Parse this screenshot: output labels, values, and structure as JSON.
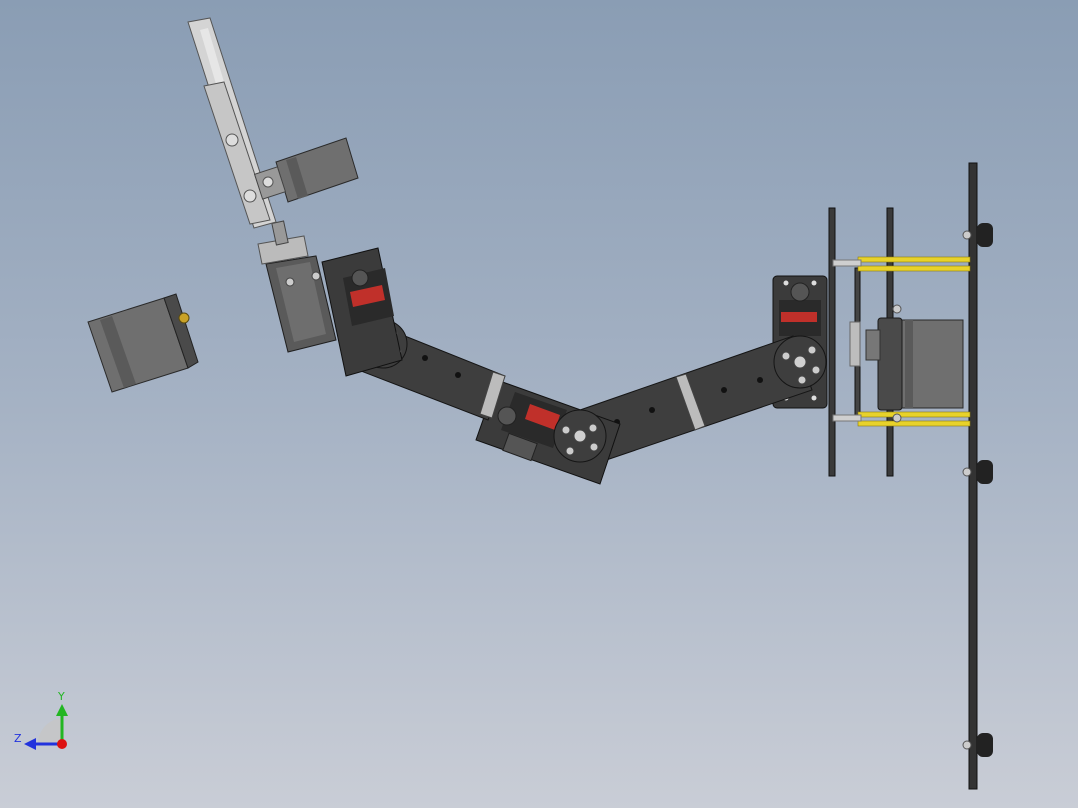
{
  "triad": {
    "y_label": "Y",
    "z_label": "Z",
    "y_color": "#22b622",
    "z_color": "#2233dd",
    "x_color": "#dd1111"
  },
  "colors": {
    "bracket": "#3e3e3e",
    "bracket_edge": "#1a1a1a",
    "servo_body": "#555555",
    "motor_body": "#6f6f6f",
    "standoff": "#e8d22a",
    "bolt": "#c8c8c8",
    "gripper": "#d4d4d4",
    "servo_label": "#c0302a"
  }
}
